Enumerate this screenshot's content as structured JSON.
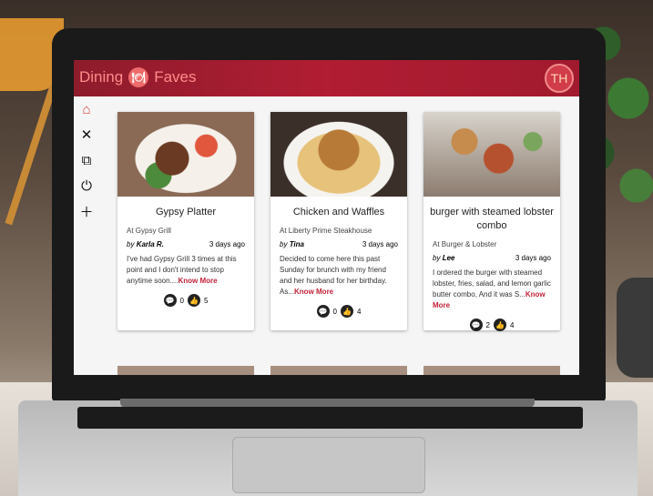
{
  "app": {
    "brand_left": "Dining",
    "brand_right": "Faves",
    "brand_logo_icon": "plate-icon",
    "avatar_text": "TH"
  },
  "sidebar": {
    "items": [
      {
        "name": "home",
        "icon": "⌂"
      },
      {
        "name": "restaurants",
        "icon": "✕"
      },
      {
        "name": "add-photo",
        "icon": "⧉"
      },
      {
        "name": "logout",
        "icon": "⏻"
      },
      {
        "name": "add-friend",
        "icon": "＋"
      }
    ]
  },
  "cards": [
    {
      "title": "Gypsy Platter",
      "restaurant": "At Gypsy Grill",
      "by_prefix": "by",
      "author": "Karla R.",
      "time": "3 days ago",
      "text": "I've had Gypsy Grill 3 times at this point and I don't intend to stop anytime soon....",
      "more": "Know More",
      "comments": "0",
      "likes": "5"
    },
    {
      "title": "Chicken and Waffles",
      "restaurant": "At Liberty Prime Steakhouse",
      "by_prefix": "by",
      "author": "Tina",
      "time": "3 days ago",
      "text": "Decided to come here this past Sunday for brunch with my friend and her husband for her birthday. As...",
      "more": "Know More",
      "comments": "0",
      "likes": "4"
    },
    {
      "title": "burger with steamed lobster combo",
      "restaurant": "At Burger & Lobster",
      "by_prefix": "by",
      "author": "Lee",
      "time": "3 days ago",
      "text": "I ordered the burger with steamed lobster, fries, salad, and lemon garlic butter combo, And it was S...",
      "more": "Know More",
      "comments": "2",
      "likes": "4"
    }
  ],
  "colors": {
    "appbar": "#b11d33",
    "accent": "#c3223a",
    "active_icon": "#d83838"
  }
}
